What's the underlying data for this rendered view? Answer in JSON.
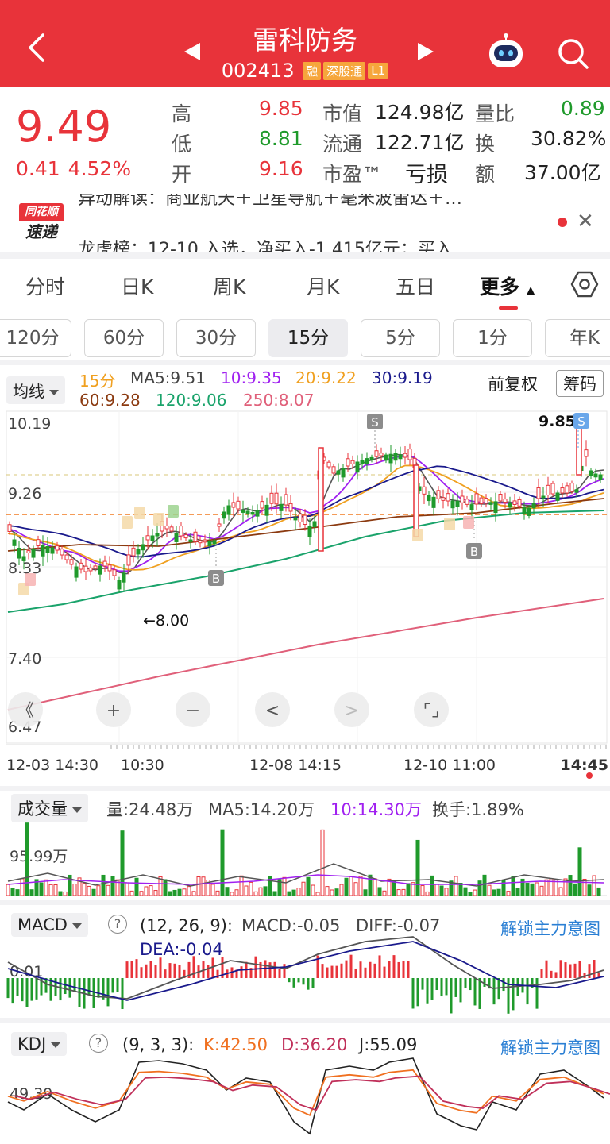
{
  "header": {
    "stock_name": "雷科防务",
    "stock_code": "002413",
    "tags": [
      "融",
      "深股通",
      "L1"
    ]
  },
  "quote": {
    "price": "9.49",
    "change": "0.41",
    "change_pct": "4.52%",
    "high_label": "高",
    "high": "9.85",
    "low_label": "低",
    "low": "8.81",
    "open_label": "开",
    "open": "9.16",
    "mktcap_label": "市值",
    "mktcap": "124.98亿",
    "float_label": "流通",
    "float": "122.71亿",
    "pe_label": "市盈™",
    "pe": "亏损",
    "volratio_label": "量比",
    "volratio": "0.89",
    "turnover_label": "换",
    "turnover": "30.82%",
    "amount_label": "额",
    "amount": "37.00亿"
  },
  "news": {
    "logo_top": "同花顺",
    "logo_bottom": "速递",
    "line1": "异动解读：商业航天＋卫星导航＋毫米波雷达＋…",
    "line2": "龙虎榜：12-10 入选，净买入-1.415亿元；买入"
  },
  "tabs": [
    "分时",
    "日K",
    "周K",
    "月K",
    "五日",
    "更多"
  ],
  "active_tab": "更多",
  "periods": [
    "120分",
    "60分",
    "30分",
    "15分",
    "5分",
    "1分",
    "年K"
  ],
  "selected_period": "15分",
  "ma": {
    "dropdown": "均线",
    "period": "15分",
    "ma5": "MA5:9.51",
    "ma10": "10:9.35",
    "ma20": "20:9.22",
    "ma30": "30:9.19",
    "ma60": "60:9.28",
    "ma120": "120:9.06",
    "ma250": "250:8.07",
    "fq": "前复权",
    "chips": "筹码"
  },
  "kline": {
    "y_labels": [
      "10.19",
      "9.26",
      "8.33",
      "7.40",
      "6.47"
    ],
    "x_labels": [
      "12-03 14:30",
      "10:30",
      "12-08 14:15",
      "12-10 11:00",
      "14:45"
    ],
    "max_label": "9.85",
    "min_label": "8.00",
    "markers": {
      "s": "S",
      "b": "B"
    },
    "controls": [
      "《",
      "+",
      "−",
      "<",
      ">",
      "⌜⌟"
    ]
  },
  "volume": {
    "dropdown": "成交量",
    "vol": "量:24.48万",
    "ma5": "MA5:14.20万",
    "ma10": "10:14.30万",
    "turnover": "换手:1.89%",
    "y_label": "95.99万"
  },
  "macd": {
    "dropdown": "MACD",
    "params": "(12, 26, 9):",
    "macd": "MACD:-0.05",
    "diff": "DIFF:-0.07",
    "dea": "DEA:-0.04",
    "unlock": "解锁主力意图",
    "y_label": "0.01"
  },
  "kdj": {
    "dropdown": "KDJ",
    "params": "(9, 3, 3):",
    "k": "K:42.50",
    "d": "D:36.20",
    "j": "J:55.09",
    "unlock": "解锁主力意图",
    "y_label": "49.39"
  },
  "colors": {
    "red": "#e8333a",
    "green": "#1f9a2b",
    "ma5": "#555555",
    "ma10": "#a020f0",
    "ma20": "#f0a020",
    "ma30": "#1a1a8c",
    "ma60": "#8b3a10",
    "ma120": "#1aa36b",
    "ma250": "#e0607a"
  }
}
